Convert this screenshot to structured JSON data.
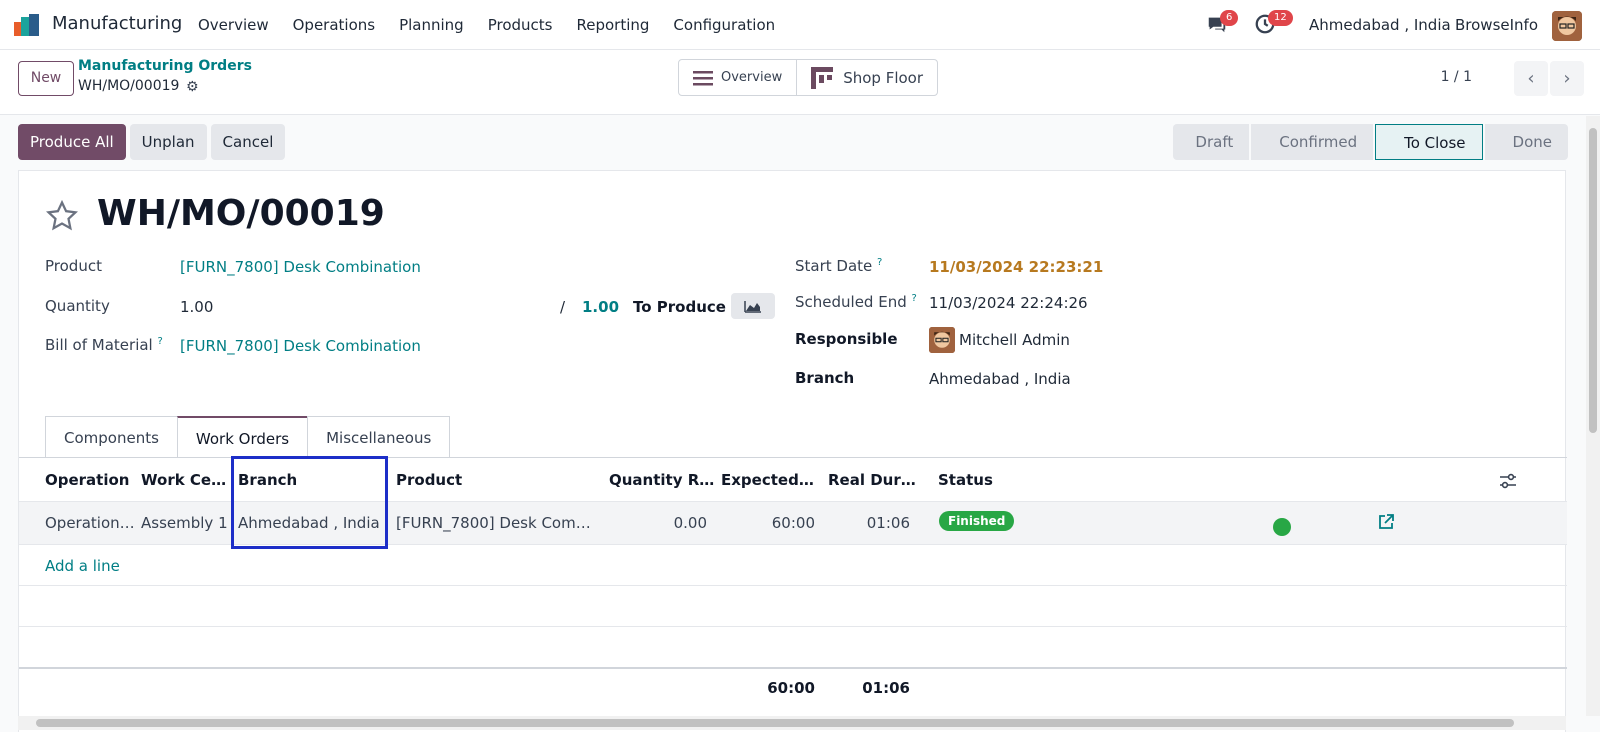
{
  "navbar": {
    "app_name": "Manufacturing",
    "menu": [
      "Overview",
      "Operations",
      "Planning",
      "Products",
      "Reporting",
      "Configuration"
    ],
    "chat_count": "6",
    "activity_count": "12",
    "branch": "Ahmedabad , India",
    "company": "BrowseInfo"
  },
  "control_panel": {
    "new_label": "New",
    "breadcrumb_parent": "Manufacturing Orders",
    "breadcrumb_current": "WH/MO/00019",
    "views": [
      "Overview",
      "Shop Floor"
    ],
    "pager": "1 / 1"
  },
  "actions": {
    "produce_all": "Produce All",
    "unplan": "Unplan",
    "cancel": "Cancel"
  },
  "stages": [
    "Draft",
    "Confirmed",
    "To Close",
    "Done"
  ],
  "form": {
    "title": "WH/MO/00019",
    "product_label": "Product",
    "product_value": "[FURN_7800] Desk Combination",
    "quantity_label": "Quantity",
    "quantity_value": "1.00",
    "quantity_sep": "/",
    "quantity_target": "1.00",
    "to_produce": "To Produce",
    "bom_label": "Bill of Material",
    "bom_value": "[FURN_7800] Desk Combination",
    "start_label": "Start Date",
    "start_value": "11/03/2024 22:23:21",
    "end_label": "Scheduled End",
    "end_value": "11/03/2024 22:24:26",
    "responsible_label": "Responsible",
    "responsible_value": "Mitchell Admin",
    "branch_label": "Branch",
    "branch_value": "Ahmedabad , India",
    "help_mark": "?"
  },
  "tabs": [
    "Components",
    "Work Orders",
    "Miscellaneous"
  ],
  "table": {
    "headers": [
      "Operation",
      "Work Cen…",
      "Branch",
      "Product",
      "Quantity Re…",
      "Expected D…",
      "Real Dura…",
      "Status"
    ],
    "row": {
      "operation": "Operation…",
      "work_center": "Assembly 1",
      "branch": "Ahmedabad , India",
      "product": "[FURN_7800] Desk Combin…",
      "quantity": "0.00",
      "expected": "60:00",
      "real": "01:06",
      "status": "Finished"
    },
    "add_line": "Add a line",
    "total_expected": "60:00",
    "total_real": "01:06"
  },
  "colors": {
    "brand": "#714b67",
    "link": "#017e84",
    "success": "#28a745",
    "highlight": "#1d2ec8"
  }
}
